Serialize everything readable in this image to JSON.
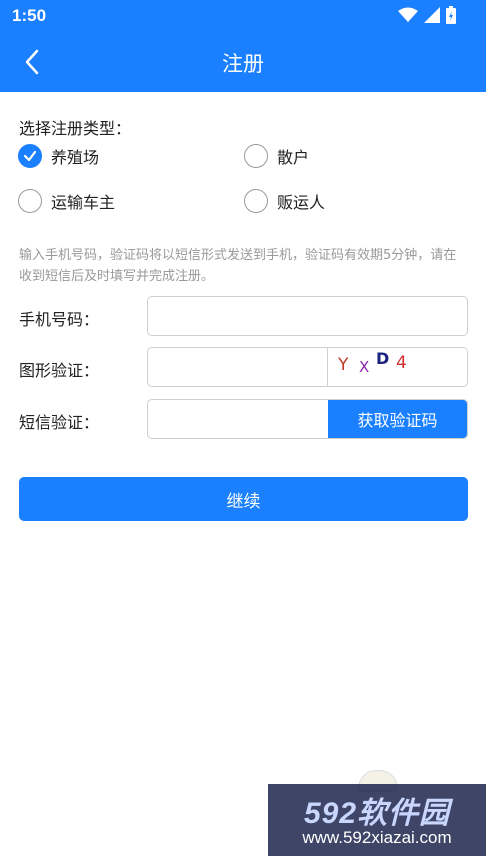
{
  "status_bar": {
    "time": "1:50"
  },
  "app_bar": {
    "title": "注册"
  },
  "register_type": {
    "label": "选择注册类型：",
    "options": [
      {
        "label": "养殖场",
        "checked": true
      },
      {
        "label": "散户",
        "checked": false
      },
      {
        "label": "运输车主",
        "checked": false
      },
      {
        "label": "贩运人",
        "checked": false
      }
    ]
  },
  "hint": "输入手机号码，验证码将以短信形式发送到手机，验证码有效期5分钟，请在收到短信后及时填写并完成注册。",
  "form": {
    "phone_label": "手机号码：",
    "phone_value": "",
    "captcha_label": "图形验证：",
    "captcha_value": "",
    "captcha_chars": [
      "Y",
      "X",
      "D",
      "4"
    ],
    "sms_label": "短信验证：",
    "sms_value": "",
    "sms_button": "获取验证码"
  },
  "continue_button": "继续",
  "watermark": {
    "main": "592软件园",
    "sub": "www.592xiazai.com"
  },
  "colors": {
    "primary": "#1a80ff",
    "hint": "#999999",
    "border": "#cfcfcf"
  }
}
